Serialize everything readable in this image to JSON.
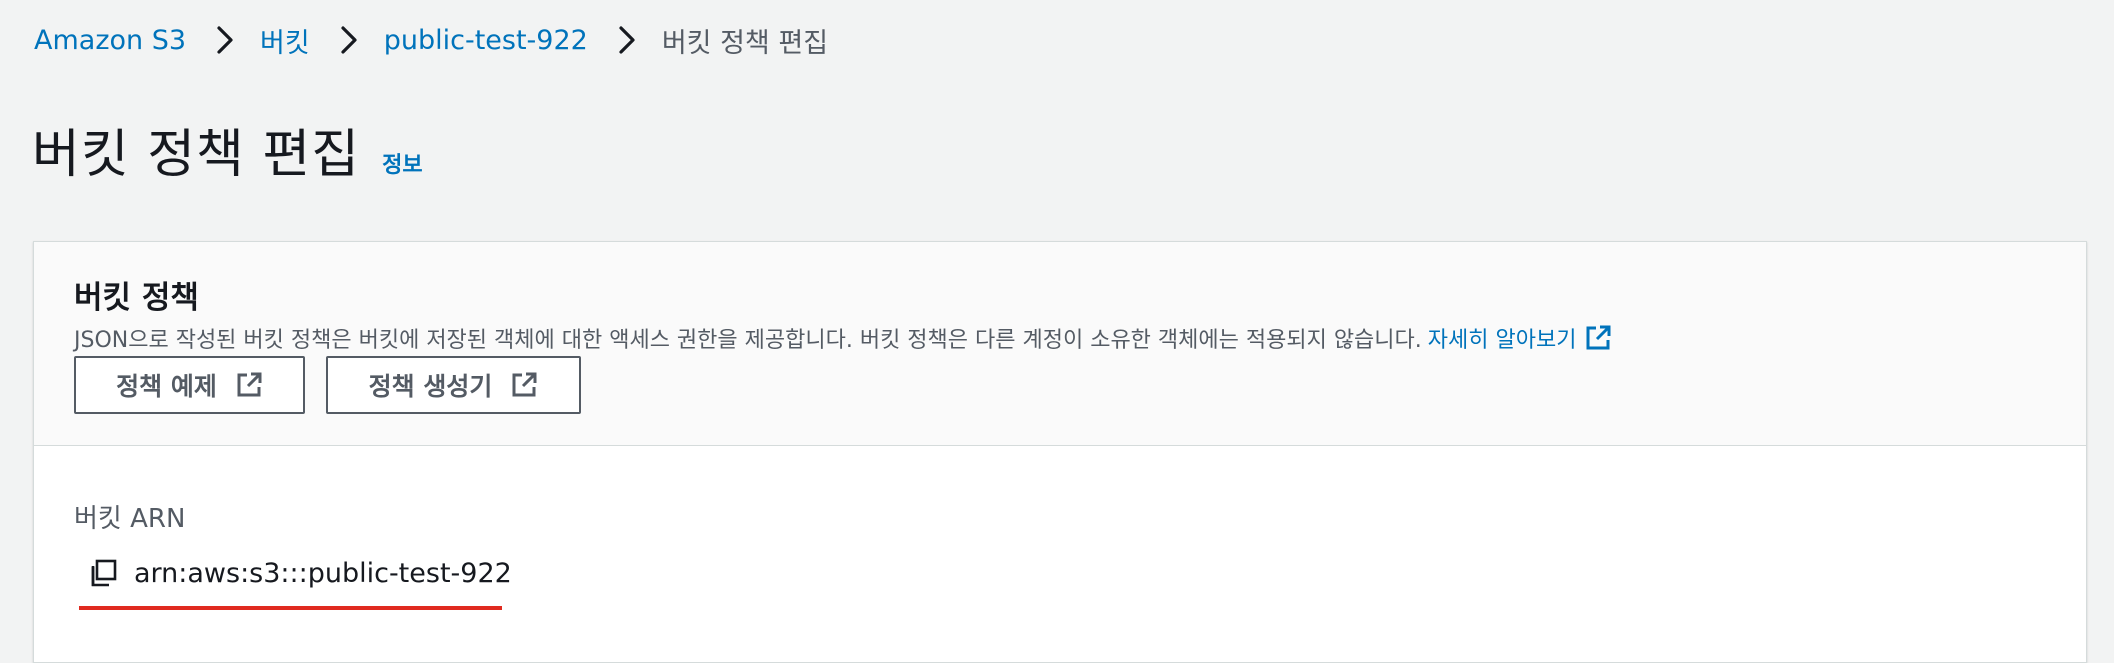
{
  "breadcrumb": {
    "items": [
      {
        "label": "Amazon S3",
        "link": true
      },
      {
        "label": "버킷",
        "link": true
      },
      {
        "label": "public-test-922",
        "link": true
      },
      {
        "label": "버킷 정책 편집",
        "link": false
      }
    ]
  },
  "header": {
    "title": "버킷 정책 편집",
    "info_link": "정보"
  },
  "policy_panel": {
    "title": "버킷 정책",
    "description": "JSON으로 작성된 버킷 정책은 버킷에 저장된 객체에 대한 액세스 권한을 제공합니다. 버킷 정책은 다른 계정이 소유한 객체에는 적용되지 않습니다.",
    "learn_more": "자세히 알아보기",
    "examples_button": "정책 예제",
    "generator_button": "정책 생성기"
  },
  "arn": {
    "label": "버킷 ARN",
    "value": "arn:aws:s3:::public-test-922"
  },
  "colors": {
    "link": "#0073bb",
    "text": "#16191f",
    "secondary_text": "#545b64",
    "background": "#f2f3f3",
    "annotation_underline": "#e02a1f"
  },
  "icons": {
    "separator": "chevron-right-icon",
    "external": "external-link-icon",
    "copy": "copy-icon"
  }
}
